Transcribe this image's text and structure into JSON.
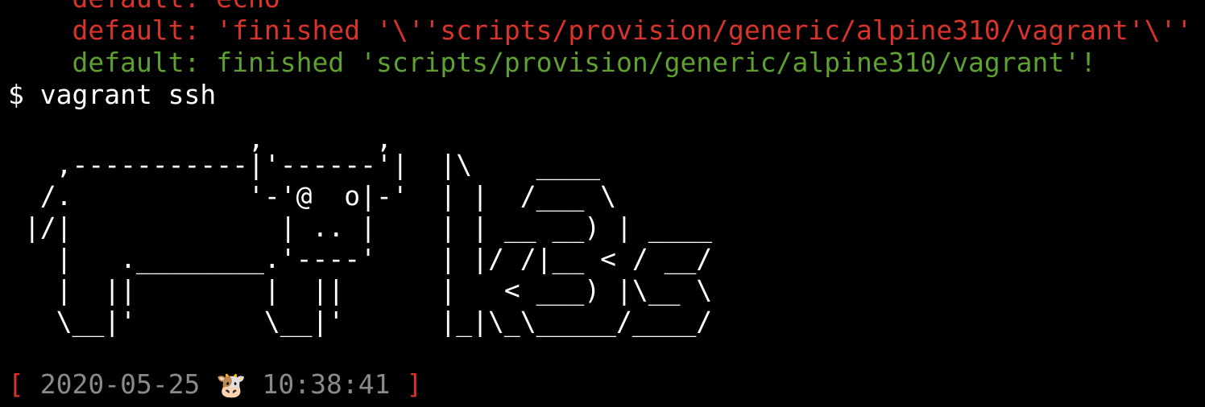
{
  "terminal": {
    "lines": [
      {
        "text": "    default: echo",
        "color": "#d9332b"
      },
      {
        "text": "    default: 'finished '\\''scripts/provision/generic/alpine310/vagrant'\\''",
        "color": "#d9332b"
      },
      {
        "text": "    default: finished 'scripts/provision/generic/alpine310/vagrant'!",
        "color": "#5fa130"
      },
      {
        "text": "$ vagrant ssh",
        "color": "#ffffff"
      },
      {
        "text": "",
        "color": "#ffffff"
      },
      {
        "text": "               ,       ,",
        "color": "#ffffff"
      },
      {
        "text": "   ,-----------|'------'|  |\\    ____",
        "color": "#ffffff"
      },
      {
        "text": "  /.           '-'@  o|-'  | |  /___ \\",
        "color": "#ffffff"
      },
      {
        "text": " |/|             | .. |    | | __ __) | ____",
        "color": "#ffffff"
      },
      {
        "text": "   |   .________.'----'    | |/ /|__ < / __/",
        "color": "#ffffff"
      },
      {
        "text": "   |  ||        |  ||      |   < ___) |\\__ \\",
        "color": "#ffffff"
      },
      {
        "text": "   \\__|'        \\__|'      |_|\\_\\_____/____/",
        "color": "#ffffff"
      }
    ],
    "prompt": {
      "open_bracket": "[",
      "date": "2020-05-25",
      "emoji": "🐮",
      "time": "10:38:41",
      "close_bracket": "]"
    }
  }
}
